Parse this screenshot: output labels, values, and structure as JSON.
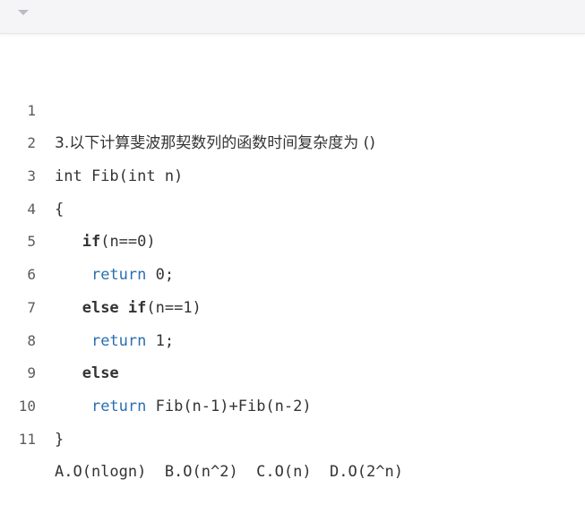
{
  "toolbar": {
    "collapse_icon": "caret-down-icon"
  },
  "code": {
    "lines": [
      {
        "num": "1",
        "text": "3.以下计算斐波那契数列的函数时间复杂度为 ()"
      },
      {
        "num": "2",
        "text": "int Fib(int n)"
      },
      {
        "num": "3",
        "text": "{"
      },
      {
        "num": "4",
        "indent": "   ",
        "kw": "if",
        "rest": "(n==0)"
      },
      {
        "num": "5",
        "indent": "    ",
        "kw": "return",
        "rest": " 0;"
      },
      {
        "num": "6",
        "indent": "   ",
        "kw": "else if",
        "rest": "(n==1)"
      },
      {
        "num": "7",
        "indent": "    ",
        "kw": "return",
        "rest": " 1;"
      },
      {
        "num": "8",
        "indent": "   ",
        "kw": "else",
        "rest": ""
      },
      {
        "num": "9",
        "indent": "    ",
        "kw": "return",
        "rest": " Fib(n-1)+Fib(n-2)"
      },
      {
        "num": "10",
        "text": "}"
      },
      {
        "num": "11",
        "text": "A.O(nlogn)  B.O(n^2)  C.O(n)  D.O(2^n)"
      }
    ]
  },
  "colors": {
    "keyword_blue": "#2a6fb1",
    "text": "#333333",
    "line_number": "#5c5c5c",
    "toolbar_bg": "#f5f5f7"
  }
}
